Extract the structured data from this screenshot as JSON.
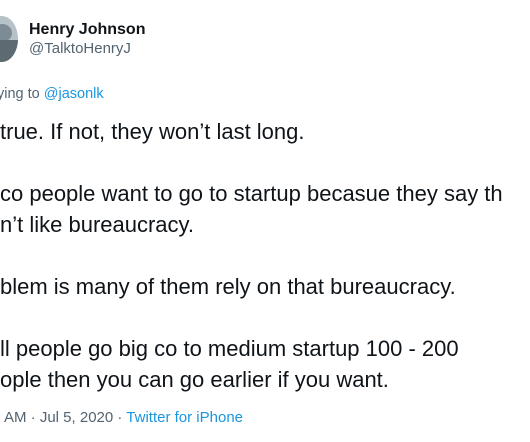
{
  "author": {
    "display_name": "Henry Johnson",
    "handle": "@TalktoHenryJ"
  },
  "reply_context": {
    "prefix": "ying to ",
    "mention": "@jasonlk"
  },
  "tweet_lines": [
    "true. If not, they won’t last long.",
    " co people want to go to startup becasue they say th",
    "n’t like bureaucracy.",
    "blem is many of them rely on that bureaucracy.",
    "ll people go big co to medium startup 100 - 200",
    "ople then you can go earlier if you want."
  ],
  "meta": {
    "time": "AM",
    "separator": " · ",
    "date": "Jul 5, 2020",
    "source": "Twitter for iPhone"
  }
}
